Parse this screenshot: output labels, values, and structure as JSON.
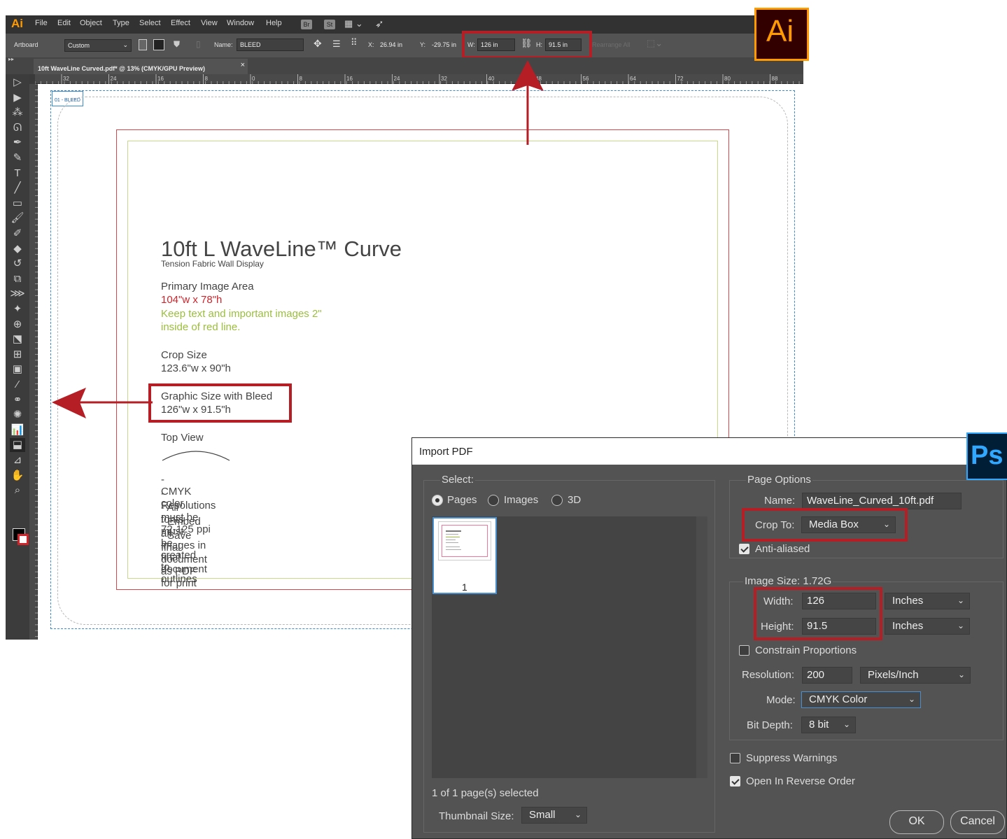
{
  "illustrator": {
    "logo": "Ai",
    "badge": "Ai",
    "menu": [
      "File",
      "Edit",
      "Object",
      "Type",
      "Select",
      "Effect",
      "View",
      "Window",
      "Help"
    ],
    "menu_buttons": [
      "Br",
      "St"
    ],
    "control": {
      "artboard_label": "Artboard",
      "preset": "Custom",
      "name_label": "Name:",
      "name_value": "BLEED",
      "x_label": "X:",
      "x_value": "26.94 in",
      "y_label": "Y:",
      "y_value": "-29.75 in",
      "w_label": "W:",
      "w_value": "126 in",
      "h_label": "H:",
      "h_value": "91.5 in",
      "rearrange": "Rearrange All"
    },
    "doc_tab": "10ft  WaveLine Curved.pdf* @ 13% (CMYK/GPU Preview)",
    "doc_tab_close": "×",
    "ruler_labels": [
      "32",
      "24",
      "16",
      "8",
      "0",
      "8",
      "16",
      "24",
      "32",
      "40",
      "48",
      "56",
      "64",
      "72",
      "80",
      "88"
    ],
    "artboard_label": "01 - BLEED",
    "template": {
      "title": "10ft L WaveLine™ Curve",
      "subtitle": "Tension Fabric Wall Display",
      "primary_heading": "Primary Image Area",
      "primary_size": "104\"w x  78\"h",
      "primary_note_1": "Keep text and important images 2\"",
      "primary_note_2": "inside of red line.",
      "crop_heading": "Crop Size",
      "crop_size": "123.6\"w x 90\"h",
      "graphic_heading": "Graphic Size with Bleed",
      "graphic_size": "126\"w x 91.5\"h",
      "top_view": "Top View",
      "notes": [
        "- CMYK color",
        "- Resolutions must be 72-125 ppi",
        "- All fonts must be created to outlines",
        "- Embed all images in final document",
        "- Save final document as PDF for print"
      ]
    }
  },
  "photoshop": {
    "badge": "Ps",
    "title": "Import PDF",
    "select_label": "Select:",
    "radio_options": [
      "Pages",
      "Images",
      "3D"
    ],
    "thumbnail_number": "1",
    "selected_status": "1 of 1 page(s) selected",
    "thumbnail_size_label": "Thumbnail Size:",
    "thumbnail_size_value": "Small",
    "page_options_label": "Page Options",
    "name_label": "Name:",
    "name_value": "WaveLine_Curved_10ft.pdf",
    "crop_to_label": "Crop To:",
    "crop_to_value": "Media Box",
    "anti_aliased": "Anti-aliased",
    "image_size_label": "Image Size: 1.72G",
    "width_label": "Width:",
    "width_value": "126",
    "width_unit": "Inches",
    "height_label": "Height:",
    "height_value": "91.5",
    "height_unit": "Inches",
    "constrain": "Constrain Proportions",
    "resolution_label": "Resolution:",
    "resolution_value": "200",
    "resolution_unit": "Pixels/Inch",
    "mode_label": "Mode:",
    "mode_value": "CMYK Color",
    "bit_depth_label": "Bit Depth:",
    "bit_depth_value": "8 bit",
    "suppress_warnings": "Suppress Warnings",
    "reverse_order": "Open In Reverse Order",
    "ok": "OK",
    "cancel": "Cancel"
  },
  "colors": {
    "highlight_red": "#b41e24",
    "ai_orange": "#ff9a00",
    "ps_blue": "#31a8ff",
    "safe_green": "#9bbf3c"
  }
}
